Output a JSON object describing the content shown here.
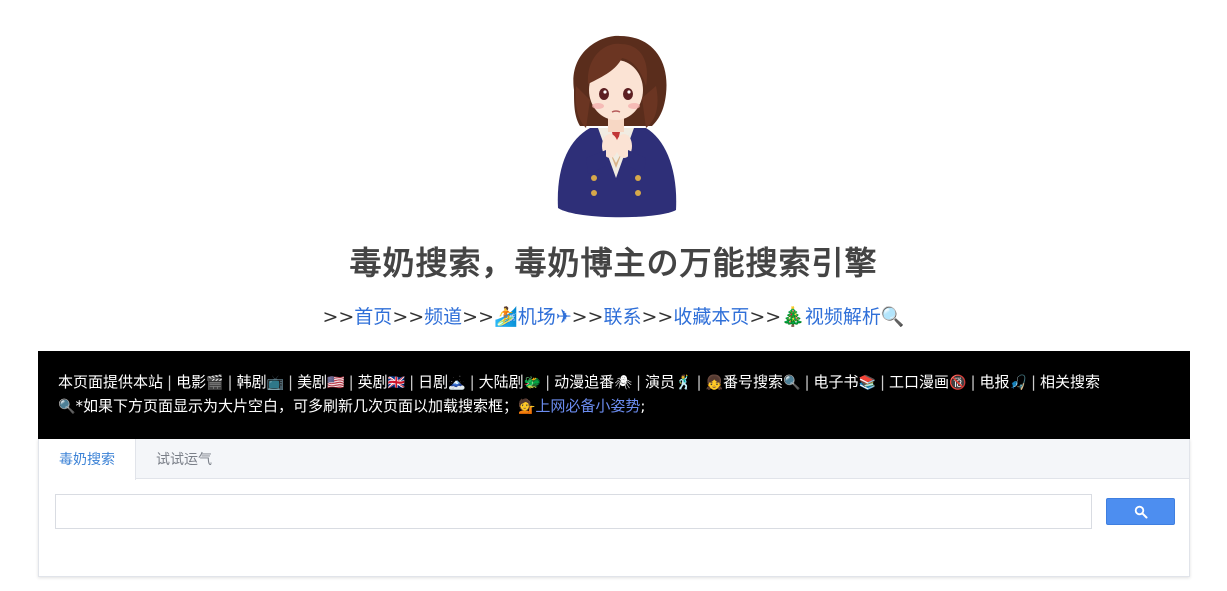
{
  "title": "毒奶搜索，毒奶博主の万能搜索引擎",
  "nav": {
    "prefix_sep": ">>",
    "items": [
      {
        "label": "首页",
        "icon": ""
      },
      {
        "label": "频道",
        "icon": ""
      },
      {
        "label": "机场",
        "icon_before": "🏄",
        "icon_after": "✈"
      },
      {
        "label": "联系",
        "icon": ""
      },
      {
        "label": "收藏本页",
        "icon": ""
      },
      {
        "label": "视频解析",
        "icon_before": "🎄",
        "icon_after": "🔍"
      }
    ]
  },
  "info": {
    "line1_intro": "本页面提供本站",
    "categories": [
      {
        "label": "电影",
        "icon": "🎬"
      },
      {
        "label": "韩剧",
        "icon": "📺"
      },
      {
        "label": "美剧",
        "icon": "🇺🇸"
      },
      {
        "label": "英剧",
        "icon": "🇬🇧"
      },
      {
        "label": "日剧",
        "icon": "🗻"
      },
      {
        "label": "大陆剧",
        "icon": "🐲"
      },
      {
        "label": "动漫追番",
        "icon": "🕷"
      },
      {
        "label": "演员",
        "icon": "🕺"
      },
      {
        "label": "番号搜索",
        "icon_before": "👧",
        "icon": "🔍"
      },
      {
        "label": "电子书",
        "icon": "📚"
      },
      {
        "label": "工口漫画",
        "icon": "🔞"
      },
      {
        "label": "电报",
        "icon": "🎣"
      },
      {
        "label": "相关搜索",
        "icon": ""
      }
    ],
    "line2_icon": "🔍",
    "line2_text": "*如果下方页面显示为大片空白，可多刷新几次页面以加载搜索框；",
    "link_icon": "💁",
    "link_label": "上网必备小姿势",
    "link_tail": ";"
  },
  "search": {
    "tabs": [
      "毒奶搜索",
      "试试运气"
    ],
    "active_tab": 0,
    "input_value": "",
    "button_icon": "search-icon"
  },
  "colors": {
    "link": "#2f6fd8",
    "info_bg": "#000000",
    "button": "#4d8ef0",
    "active_tab": "#3b82d6"
  }
}
